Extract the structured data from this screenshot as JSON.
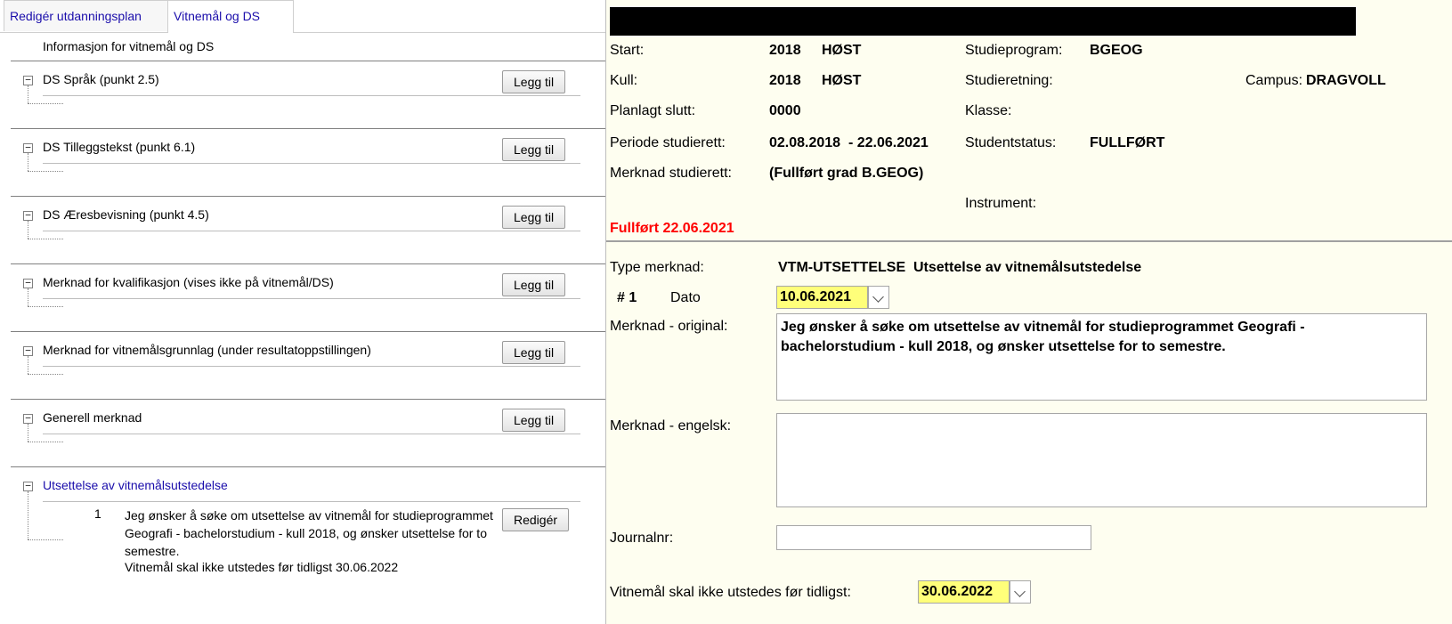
{
  "tabs": [
    {
      "label": "Redigér utdanningsplan",
      "active": false
    },
    {
      "label": "Vitnemål og DS",
      "active": true
    }
  ],
  "left": {
    "info": "Informasjon for vitnemål og DS",
    "sections": [
      {
        "title": "DS Språk (punkt 2.5)",
        "button": "Legg til"
      },
      {
        "title": "DS Tilleggstekst (punkt 6.1)",
        "button": "Legg til"
      },
      {
        "title": "DS Æresbevisning (punkt 4.5)",
        "button": "Legg til"
      },
      {
        "title": "Merknad for kvalifikasjon (vises ikke på vitnemål/DS)",
        "button": "Legg til"
      },
      {
        "title": "Merknad for vitnemålsgrunnlag (under resultatoppstillingen)",
        "button": "Legg til"
      },
      {
        "title": "Generell merknad",
        "button": "Legg til"
      },
      {
        "title": "Utsettelse av vitnemålsutstedelse",
        "button": "Redigér",
        "item_number": "1",
        "item_text": "Jeg ønsker å søke om utsettelse av vitnemål for studieprogrammet Geografi - bachelorstudium - kull 2018, og ønsker utsettelse for to semestre.",
        "item_note": "Vitnemål skal ikke utstedes før tidligst 30.06.2022"
      }
    ]
  },
  "right": {
    "start_label": "Start:",
    "start_year": "2018",
    "start_term": "HØST",
    "kull_label": "Kull:",
    "kull_year": "2018",
    "kull_term": "HØST",
    "planlagt_label": "Planlagt slutt:",
    "planlagt_value": "0000",
    "periode_label": "Periode studierett:",
    "periode_value": "02.08.2018  - 22.06.2021",
    "merknad_studierett_label": "Merknad studierett:",
    "merknad_studierett_value": "(Fullført grad B.GEOG)",
    "studieprogram_label": "Studieprogram:",
    "studieprogram_value": "BGEOG",
    "studieretning_label": "Studieretning:",
    "klasse_label": "Klasse:",
    "studentstatus_label": "Studentstatus:",
    "studentstatus_value": "FULLFØRT",
    "instrument_label": "Instrument:",
    "campus_label": "Campus:",
    "campus_value": "DRAGVOLL",
    "fullfort": "Fullført 22.06.2021",
    "type_merknad_label": "Type merknad:",
    "type_merknad_value": "VTM-UTSETTELSE  Utsettelse av vitnemålsutstedelse",
    "hash_number": "# 1",
    "dato_label": "Dato",
    "dato_value": "10.06.2021",
    "original_label": "Merknad - original:",
    "original_value": "Jeg ønsker å søke om utsettelse av vitnemål for studieprogrammet Geografi - bachelorstudium - kull 2018, og ønsker utsettelse for to semestre.",
    "engelsk_label": "Merknad - engelsk:",
    "engelsk_value": "",
    "journalnr_label": "Journalnr:",
    "journalnr_value": "",
    "vitnemal_label": "Vitnemål skal ikke utstedes før tidligst:",
    "vitnemal_value": "30.06.2022"
  },
  "colors": {
    "link": "#1a0dab",
    "status_red": "#ff0000",
    "date_highlight": "#ffff7a",
    "pane_bg": "#fefef0"
  }
}
